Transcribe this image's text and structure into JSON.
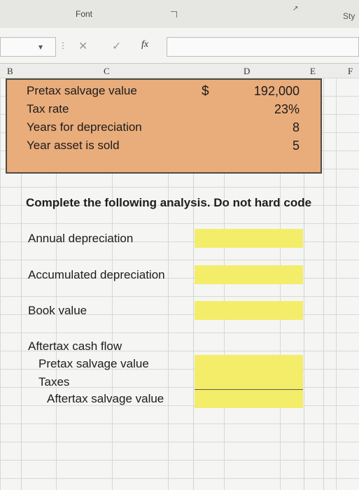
{
  "ribbon": {
    "font_group_label": "Font",
    "styles_label": "Sty"
  },
  "formula_bar": {
    "name_box_value": "",
    "cancel_symbol": "✕",
    "enter_symbol": "✓",
    "fx_label": "fx",
    "formula_value": ""
  },
  "columns": [
    "B",
    "C",
    "D",
    "E",
    "F"
  ],
  "inputs": {
    "rows": [
      {
        "label": "Pretax salvage value",
        "value": "192,000",
        "currency": "$"
      },
      {
        "label": "Tax rate",
        "value": "23%"
      },
      {
        "label": "Years for depreciation",
        "value": "8"
      },
      {
        "label": "Year asset is sold",
        "value": "5"
      }
    ],
    "fill_color": "#e9ac7b"
  },
  "instruction": "Complete the following analysis. Do not hard code",
  "analysis": {
    "annual_depreciation": "Annual depreciation",
    "accumulated_depreciation": "Accumulated depreciation",
    "book_value": "Book value",
    "aftertax_cash_flow": "Aftertax cash flow",
    "pretax_salvage_value": "Pretax salvage value",
    "taxes": "Taxes",
    "aftertax_salvage_value": "Aftertax salvage value",
    "answer_fill_color": "#f3ed6a"
  }
}
